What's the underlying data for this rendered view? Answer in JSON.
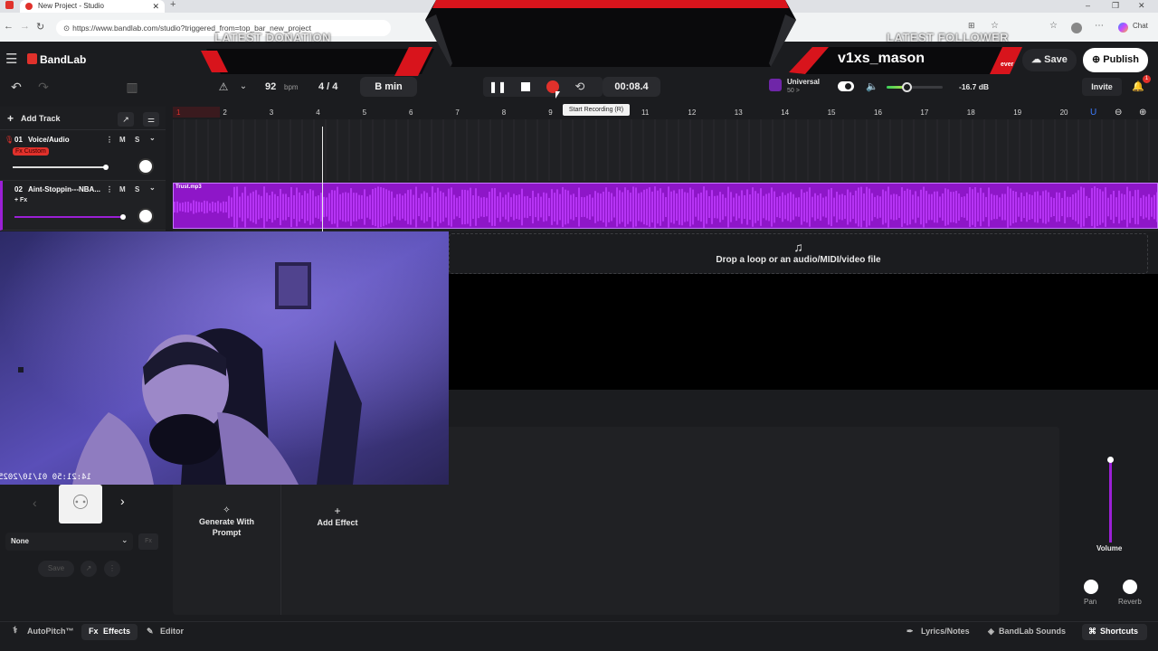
{
  "browser": {
    "tab_title": "New Project - Studio",
    "url": "https://www.bandlab.com/studio?triggered_from=top_bar_new_project",
    "chat_label": "Chat"
  },
  "overlay": {
    "latest_donation_label": "LATEST DONATION",
    "latest_follower_label": "LATEST FOLLOWER",
    "latest_follower_name": "v1xs_mason",
    "cut_text": "ever"
  },
  "app": {
    "logo": "BandLab",
    "save_label": "Save",
    "publish_label": "Publish"
  },
  "transport": {
    "bpm_value": "92",
    "bpm_unit": "bpm",
    "time_signature": "4 / 4",
    "key": "B min",
    "time": "00:08.4",
    "tooltip": "Start Recording (R)",
    "preset_name": "Universal",
    "preset_sub": "50 >",
    "volume_db": "-16.7 dB",
    "volume_level": 0.35,
    "invite_label": "Invite",
    "notification_count": "1"
  },
  "tracks_header": {
    "add_track_label": "Add Track"
  },
  "ruler": {
    "bars": [
      "1",
      "2",
      "3",
      "4",
      "5",
      "6",
      "7",
      "8",
      "9",
      "10",
      "11",
      "12",
      "13",
      "14",
      "15",
      "16",
      "17",
      "18",
      "19",
      "20"
    ]
  },
  "tracks": [
    {
      "number": "01",
      "name": "Voice/Audio",
      "fx": "Fx Custom",
      "m": "M",
      "s": "S"
    },
    {
      "number": "02",
      "name": "Aint-Stoppin---NBA...",
      "fx": "+ Fx",
      "m": "M",
      "s": "S"
    }
  ],
  "clip": {
    "name": "Trust.mp3"
  },
  "dropzone": {
    "text": "Drop a loop or an audio/MIDI/video file"
  },
  "webcam": {
    "timestamp": "14:21:50 01/10/2025"
  },
  "fx_panel": {
    "preset_select": "None",
    "save_label": "Save",
    "generate_label_1": "Generate With",
    "generate_label_2": "Prompt",
    "add_effect_label": "Add Effect",
    "volume_label": "Volume",
    "pan_label": "Pan",
    "reverb_label": "Reverb"
  },
  "bottom_bar": {
    "autopitch": "AutoPitch™",
    "effects": "Effects",
    "editor": "Editor",
    "lyrics": "Lyrics/Notes",
    "sounds": "BandLab Sounds",
    "shortcuts": "Shortcuts"
  },
  "colors": {
    "accent_purple": "#9b1fd6",
    "record_red": "#e0312b",
    "overlay_red": "#d8141c"
  }
}
